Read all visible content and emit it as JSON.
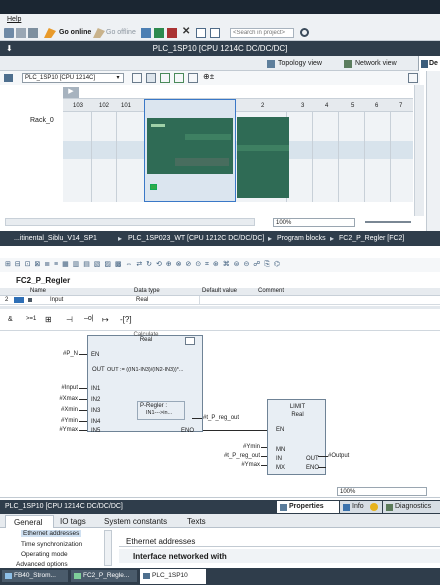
{
  "menu": {
    "help": "Help"
  },
  "toolbar": {
    "go_online": "Go online",
    "go_offline": "Go offline",
    "search_placeholder": "<Search in project>"
  },
  "device_window": {
    "title": "PLC_1SP10 [CPU 1214C DC/DC/DC]",
    "topology_view": "Topology view",
    "network_view": "Network view",
    "device_view_short": "De",
    "device_select": "PLC_1SP10 [CPU 1214C]",
    "rack_label": "Rack_0",
    "slots": [
      "103",
      "102",
      "101",
      "1",
      "2",
      "3",
      "4",
      "5",
      "6",
      "7"
    ],
    "zoom": "100%"
  },
  "breadcrumb": {
    "items": [
      "...itinental_Siblu_V14_SP1",
      "PLC_1SP023_WT [CPU 1212C DC/DC/DC]",
      "Program blocks",
      "FC2_P_Regler [FC2]"
    ]
  },
  "block": {
    "name": "FC2_P_Regler",
    "headers": {
      "name": "Name",
      "data_type": "Data type",
      "default": "Default value",
      "comment": "Comment"
    },
    "row": {
      "num": "2",
      "name": "Input",
      "type": "Real"
    }
  },
  "fbd": {
    "calc_header": "Real",
    "calc_top": "Calculate",
    "calc_expr": "OUT := ((IN1-IN3)/(IN2-IN3))*...",
    "calc_comment_title": "P-Regler :",
    "calc_comment_body": "IN1--->in...",
    "calc_pins_in": [
      "EN",
      "IN1",
      "IN2",
      "IN3",
      "IN4",
      "IN5"
    ],
    "calc_pins_out": [
      "OUT",
      "ENO"
    ],
    "calc_tags_in": [
      "#P_N",
      "#Input",
      "#Xmax",
      "#Xmin",
      "#Ymin",
      "#Ymax"
    ],
    "out_tag": "#t_P_reg_out",
    "limit_title": "LIMIT",
    "limit_type": "Real",
    "limit_pins_in": [
      "EN",
      "MN",
      "IN",
      "MX"
    ],
    "limit_pins_out": [
      "OUT",
      "ENO"
    ],
    "limit_tags_in": [
      "#Ymin",
      "#t_P_reg_out",
      "#Ymax"
    ],
    "limit_out_tag": "#Output",
    "zoom": "100%"
  },
  "inspector": {
    "title": "PLC_1SP10 [CPU 1214C DC/DC/DC]",
    "properties": "Properties",
    "info": "Info",
    "diagnostics": "Diagnostics",
    "tabs": [
      "General",
      "IO tags",
      "System constants",
      "Texts"
    ],
    "nav": [
      "Ethernet addresses",
      "Time synchronization",
      "Operating mode",
      "Advanced options"
    ],
    "section": "Ethernet addresses",
    "subsection": "Interface networked with"
  },
  "taskbar": {
    "items": [
      "FB40_Strom...",
      "FC2_P_Regle...",
      "PLC_1SP10"
    ]
  },
  "colors": {
    "title_bar": "#2f3d4b",
    "accent": "#0a6eb4",
    "rack": "#dfe6ec",
    "module_green": "#2f6b55"
  }
}
